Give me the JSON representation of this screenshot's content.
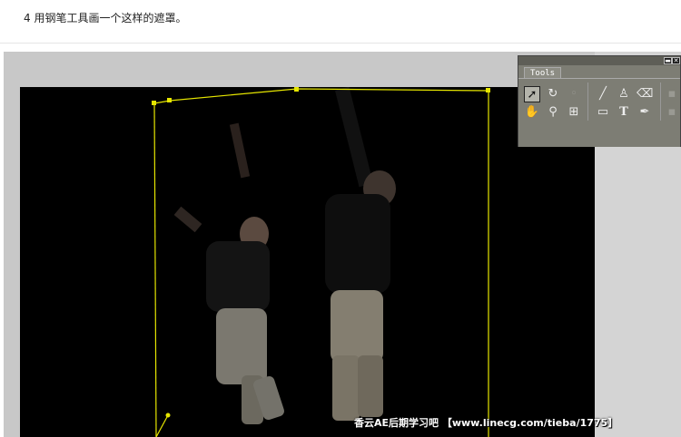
{
  "instruction": {
    "text": "4 用钢笔工具画一个这样的遮罩。"
  },
  "tools_panel": {
    "title": "Tools",
    "tools": [
      {
        "icon": "selection-arrow-icon",
        "glyph": "➚",
        "active": true
      },
      {
        "icon": "rotate-icon",
        "glyph": "↻",
        "active": false
      },
      {
        "icon": "camera-orbit-icon",
        "glyph": "◦",
        "active": false
      },
      {
        "icon": "hand-icon",
        "glyph": "✋",
        "active": false
      },
      {
        "icon": "zoom-icon",
        "glyph": "🔍",
        "active": false
      },
      {
        "icon": "pan-behind-icon",
        "glyph": "⊞",
        "active": false
      },
      {
        "icon": "brush-icon",
        "glyph": "╱",
        "active": false
      },
      {
        "icon": "clone-stamp-icon",
        "glyph": "⚇",
        "active": false
      },
      {
        "icon": "eraser-icon",
        "glyph": "⌫",
        "active": false
      },
      {
        "icon": "rectangle-mask-icon",
        "glyph": "▭",
        "active": false
      },
      {
        "icon": "text-icon",
        "glyph": "T",
        "active": false
      },
      {
        "icon": "pen-icon",
        "glyph": "✒",
        "active": false
      }
    ]
  },
  "watermark": {
    "text": "香云AE后期学习吧 【www.linecg.com/tieba/1775】"
  },
  "colors": {
    "mask_path": "#e6e600",
    "comp_bg": "#000000",
    "panel_bg": "#7d7d74"
  }
}
